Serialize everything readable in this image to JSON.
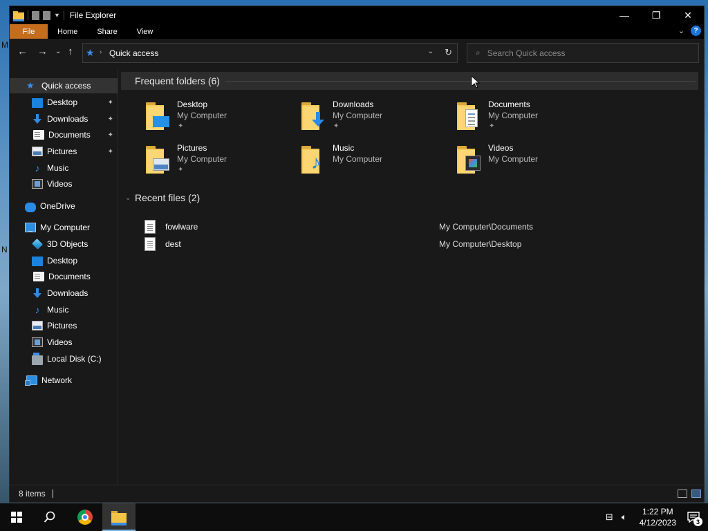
{
  "window": {
    "title": "File Explorer",
    "minimize_glyph": "—",
    "maximize_glyph": "❐",
    "close_glyph": "✕"
  },
  "ribbon": {
    "tabs": [
      "File",
      "Home",
      "Share",
      "View"
    ],
    "expand_glyph": "⌄",
    "help_label": "?"
  },
  "navigation": {
    "back_glyph": "←",
    "forward_glyph": "→",
    "recent_glyph": "⌄",
    "up_glyph": "↑",
    "address": {
      "star_glyph": "★",
      "separator": "›",
      "crumb": "Quick access",
      "dropdown_glyph": "⌄",
      "refresh_glyph": "↻"
    },
    "search": {
      "placeholder": "Search Quick access",
      "icon": "search-icon"
    }
  },
  "sidebar": {
    "quick_access": {
      "label": "Quick access",
      "items": [
        {
          "label": "Desktop",
          "icon": "desktop-icon",
          "pinned": true
        },
        {
          "label": "Downloads",
          "icon": "downloads-icon",
          "pinned": true
        },
        {
          "label": "Documents",
          "icon": "documents-icon",
          "pinned": true
        },
        {
          "label": "Pictures",
          "icon": "pictures-icon",
          "pinned": true
        },
        {
          "label": "Music",
          "icon": "music-icon",
          "pinned": false
        },
        {
          "label": "Videos",
          "icon": "videos-icon",
          "pinned": false
        }
      ]
    },
    "onedrive": {
      "label": "OneDrive"
    },
    "my_computer": {
      "label": "My Computer",
      "items": [
        {
          "label": "3D Objects",
          "icon": "3d-objects-icon"
        },
        {
          "label": "Desktop",
          "icon": "desktop-icon"
        },
        {
          "label": "Documents",
          "icon": "documents-icon"
        },
        {
          "label": "Downloads",
          "icon": "downloads-icon"
        },
        {
          "label": "Music",
          "icon": "music-icon"
        },
        {
          "label": "Pictures",
          "icon": "pictures-icon"
        },
        {
          "label": "Videos",
          "icon": "videos-icon"
        },
        {
          "label": "Local Disk (C:)",
          "icon": "local-disk-icon"
        }
      ]
    },
    "network": {
      "label": "Network"
    },
    "pin_glyph": "📌"
  },
  "content": {
    "frequent": {
      "header": "Frequent folders (6)",
      "folders": [
        {
          "name": "Desktop",
          "location": "My Computer",
          "pinned": true
        },
        {
          "name": "Downloads",
          "location": "My Computer",
          "pinned": true
        },
        {
          "name": "Documents",
          "location": "My Computer",
          "pinned": true
        },
        {
          "name": "Pictures",
          "location": "My Computer",
          "pinned": true
        },
        {
          "name": "Music",
          "location": "My Computer",
          "pinned": false
        },
        {
          "name": "Videos",
          "location": "My Computer",
          "pinned": false
        }
      ]
    },
    "recent": {
      "header": "Recent files (2)",
      "files": [
        {
          "name": "fowlware",
          "path": "My Computer\\Documents"
        },
        {
          "name": "dest",
          "path": "My Computer\\Desktop"
        }
      ]
    }
  },
  "status": {
    "count": "8 items"
  },
  "taskbar": {
    "clock_time": "1:22 PM",
    "clock_date": "4/12/2023",
    "notification_count": "3"
  },
  "colors": {
    "file_tab": "#c46d1d",
    "accent": "#2a8ae5",
    "folder": "#f6c958"
  }
}
